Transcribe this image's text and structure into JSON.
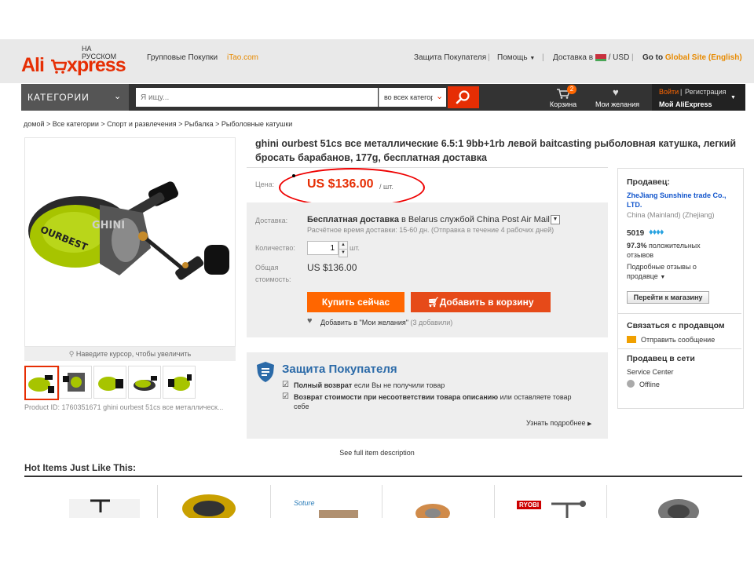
{
  "logo": {
    "brand_left": "Ali",
    "brand_right": "xpress",
    "locale": "НА РУССКОМ"
  },
  "topnav": {
    "group": "Групповые Покупки",
    "itao": "iTao.com",
    "protection": "Защита Покупателя",
    "help": "Помощь",
    "delivery": "Доставка в",
    "currency": "USD",
    "goto_prefix": "Go to",
    "goto_link": "Global Site (English)"
  },
  "search": {
    "categories": "КАТЕГОРИИ",
    "placeholder": "Я ищу...",
    "scope": "во всех категориях",
    "cart_label": "Корзина",
    "cart_count": "2",
    "wishlist_label": "Мои желания",
    "login": "Войти",
    "register": "Регистрация",
    "my_ali": "Мой AliExpress"
  },
  "breadcrumb": "домой > Все категории > Спорт и развлечения > Рыбалка > Рыболовные катушки",
  "gallery": {
    "zoom_hint": "Наведите курсор, чтобы увеличить",
    "product_id": "Product ID: 1760351671 ghini ourbest 51cs все металлическ..."
  },
  "product": {
    "title": "ghini ourbest 51cs все металлические 6.5:1 9bb+1rb левой baitcasting рыболовная катушка, легкий бросать барабанов, 177g, бесплатная доставка",
    "price_label": "Цена:",
    "price": "US $136.00",
    "price_unit": "/ шт.",
    "delivery_label": "Доставка:",
    "delivery_free": "Бесплатная доставка",
    "delivery_in": "в",
    "delivery_country": "Belarus",
    "delivery_service": "службой China Post Air Mail",
    "delivery_time": "Расчётное время доставки: 15-60 дн. (Отправка в течение 4 рабочих дней)",
    "qty_label": "Количество:",
    "qty_value": "1",
    "qty_unit": "шт.",
    "total_label_1": "Общая",
    "total_label_2": "стоимость:",
    "total_value": "US $136.00",
    "buy_now": "Купить сейчас",
    "add_cart": "Добавить в корзину",
    "wishlist": "Добавить в \"Мои желания\"",
    "wishlist_count": "(3 добавили)"
  },
  "protection": {
    "title": "Защита Покупателя",
    "item1_bold": "Полный возврат",
    "item1_rest": "если Вы не получили товар",
    "item2_bold": "Возврат стоимости при несоответствии товара описанию",
    "item2_rest": "или оставляете товар",
    "item2_rest2": "себе",
    "more": "Узнать подробнее"
  },
  "seller": {
    "heading": "Продавец:",
    "name_1": "ZheJiang Sunshine trade Co.,",
    "name_2": "LTD.",
    "location": "China (Mainland) (Zhejiang)",
    "score": "5019",
    "positive_pct": "97.3%",
    "positive_text_1": "положительных",
    "positive_text_2": "отзывов",
    "detailed_1": "Подробные отзывы о",
    "detailed_2": "продавце",
    "store_btn": "Перейти к магазину",
    "contact_heading": "Связаться с продавцом",
    "send_msg": "Отправить сообщение",
    "online_heading": "Продавец в сети",
    "service_center": "Service Center",
    "status": "Offline"
  },
  "bottom": {
    "see_full": "See full item description",
    "hot_title": "Hot Items Just Like This:",
    "hot_brands": [
      "",
      "",
      "Soture",
      "",
      "RYOBI",
      ""
    ]
  },
  "colors": {
    "accent": "#e62e04",
    "orange": "#ff6600",
    "link_blue": "#1155cc",
    "annotation": "#e00000"
  }
}
